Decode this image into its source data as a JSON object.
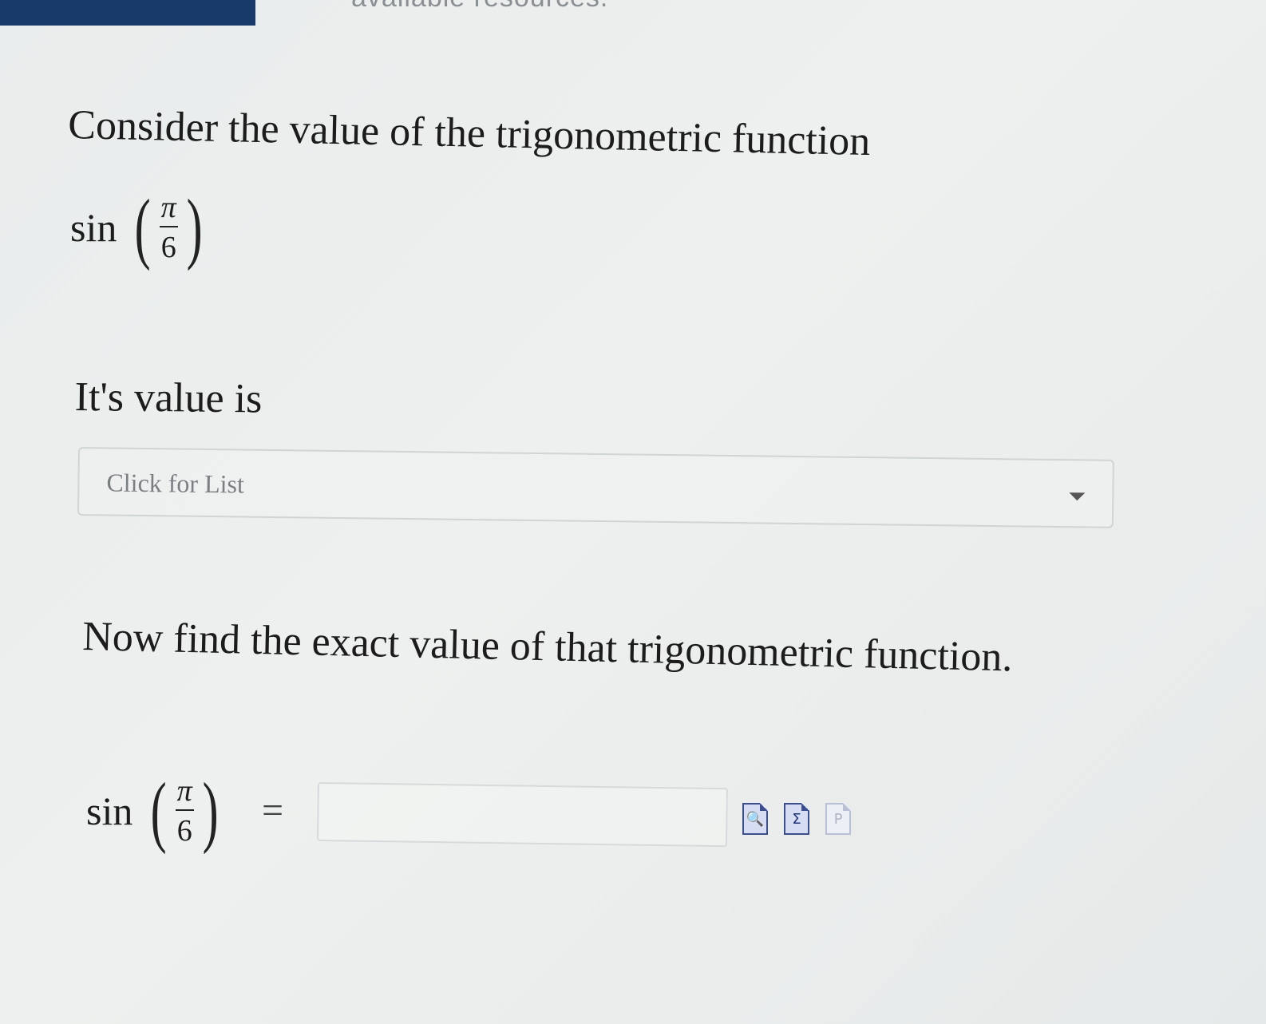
{
  "header": {
    "partial_text": "available resources."
  },
  "question": {
    "prompt": "Consider the value of the trigonometric function",
    "expression": {
      "function": "sin",
      "numerator": "π",
      "denominator": "6"
    },
    "value_label": "It's value is",
    "dropdown": {
      "placeholder": "Click for List"
    },
    "instruction": "Now find the exact value of that trigonometric function.",
    "answer_expression": {
      "function": "sin",
      "numerator": "π",
      "denominator": "6",
      "equals": "="
    },
    "answer_input": {
      "value": ""
    }
  },
  "tools": [
    {
      "icon": "preview-icon",
      "glyph": "🔍"
    },
    {
      "icon": "equation-editor-icon",
      "glyph": "Σ"
    },
    {
      "icon": "help-icon",
      "glyph": "P"
    }
  ]
}
